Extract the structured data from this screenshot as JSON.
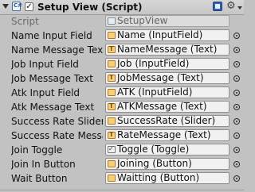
{
  "component": {
    "title": "Setup View (Script)",
    "enabled_mark": "✓",
    "header_icons": [
      "fold-arrow-icon",
      "csharp-script-icon",
      "help-book-icon",
      "gear-icon",
      "context-menu-icon"
    ]
  },
  "fields": [
    {
      "label": "Script",
      "value": "SetupView",
      "icon": "script-icon",
      "readonly": true
    },
    {
      "label": "Name Input Field",
      "value": "Name (InputField)",
      "icon": "input-field-icon"
    },
    {
      "label": "Name Message Text",
      "value": "NameMessage (Text)",
      "icon": "text-icon"
    },
    {
      "label": "Job Input Field",
      "value": "Job (InputField)",
      "icon": "input-field-icon"
    },
    {
      "label": "Job Message Text",
      "value": "JobMessage (Text)",
      "icon": "text-icon"
    },
    {
      "label": "Atk Input Field",
      "value": "ATK (InputField)",
      "icon": "input-field-icon"
    },
    {
      "label": "Atk Message Text",
      "value": "ATKMessage (Text)",
      "icon": "text-icon"
    },
    {
      "label": "Success Rate Slider",
      "value": "SuccessRate (Slider)",
      "icon": "slider-icon"
    },
    {
      "label": "Success Rate Messa",
      "value": "RateMessage (Text)",
      "icon": "text-icon"
    },
    {
      "label": "Join Toggle",
      "value": "Toggle (Toggle)",
      "icon": "toggle-icon"
    },
    {
      "label": "Join In Button",
      "value": "Joining (Button)",
      "icon": "button-icon"
    },
    {
      "label": "Wait Button",
      "value": "Waitting (Button)",
      "icon": "button-icon"
    }
  ],
  "colors": {
    "background": "#c2c2c2",
    "field_background": "#f1f1f1",
    "label_text": "#111111",
    "readonly_text": "#6a6a6a"
  }
}
